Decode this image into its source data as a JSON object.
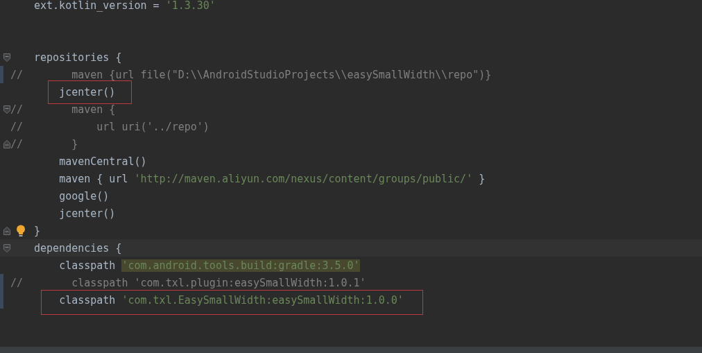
{
  "editor": {
    "lines": [
      {
        "followed_by_blank_lines": true,
        "segments": [
          {
            "kind": "code",
            "text": "ext.kotlin_version = "
          },
          {
            "kind": "string",
            "text": "'1.3.30'"
          }
        ]
      },
      {
        "fold_start": true,
        "segments": [
          {
            "kind": "code",
            "text": "repositories {"
          }
        ]
      },
      {
        "comment_marker": "//",
        "changed": true,
        "segments": [
          {
            "kind": "comment",
            "text": "      maven {url file(\"D:\\\\AndroidStudioProjects\\\\easySmallWidth\\\\repo\")}"
          }
        ]
      },
      {
        "outlined": true,
        "segments": [
          {
            "kind": "code",
            "text": "    jcenter()"
          }
        ]
      },
      {
        "comment_marker": "//",
        "fold_start": true,
        "segments": [
          {
            "kind": "comment",
            "text": "      maven {"
          }
        ]
      },
      {
        "comment_marker": "//",
        "segments": [
          {
            "kind": "comment",
            "text": "          url uri('../repo')"
          }
        ]
      },
      {
        "comment_marker": "//",
        "fold_end": true,
        "segments": [
          {
            "kind": "comment",
            "text": "      }"
          }
        ]
      },
      {
        "segments": [
          {
            "kind": "code",
            "text": "    mavenCentral()"
          }
        ]
      },
      {
        "segments": [
          {
            "kind": "code",
            "text": "    maven { url "
          },
          {
            "kind": "string",
            "text": "'http://maven.aliyun.com/nexus/content/groups/public/'"
          },
          {
            "kind": "code",
            "text": " }"
          }
        ]
      },
      {
        "segments": [
          {
            "kind": "code",
            "text": "    google()"
          }
        ]
      },
      {
        "segments": [
          {
            "kind": "code",
            "text": "    jcenter()"
          }
        ]
      },
      {
        "fold_end": true,
        "intention_bulb": true,
        "segments": [
          {
            "kind": "code",
            "text": "}"
          }
        ]
      },
      {
        "fold_start": true,
        "current": true,
        "segments": [
          {
            "kind": "code",
            "text": "dependencies {"
          }
        ]
      },
      {
        "segments": [
          {
            "kind": "code",
            "text": "    classpath "
          },
          {
            "kind": "highlighted_string",
            "text": "'com.android.tools.build:gradle:3.5.0'"
          }
        ]
      },
      {
        "comment_marker": "//",
        "changed": true,
        "segments": [
          {
            "kind": "comment",
            "text": "      classpath 'com.txl.plugin:easySmallWidth:1.0.1'"
          }
        ]
      },
      {
        "outlined": true,
        "changed": true,
        "segments": [
          {
            "kind": "code",
            "text": "    classpath "
          },
          {
            "kind": "string",
            "text": "'com.txl.EasySmallWidth:easySmallWidth:1.0.0'"
          }
        ]
      }
    ]
  }
}
